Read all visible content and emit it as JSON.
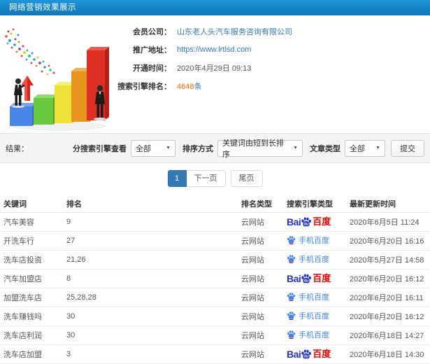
{
  "header": {
    "title": "网络营销效果展示"
  },
  "member": {
    "company_label": "会员公司：",
    "company_value": "山东老人头汽车服务咨询有限公司",
    "url_label": "推广地址：",
    "url_value": "https://www.lrtlsd.com",
    "open_label": "开通时间：",
    "open_value": "2020年4月29日 09:13",
    "rank_label": "搜索引擎排名：",
    "rank_count": "4648",
    "rank_unit": "条"
  },
  "filters": {
    "result_label": "结果：",
    "engine_label": "分搜索引擎查看",
    "engine_value": "全部",
    "sort_label": "排序方式",
    "sort_value": "关键词由短到长排序",
    "article_label": "文章类型",
    "article_value": "全部",
    "submit_label": "提交"
  },
  "pagination": {
    "current": "1",
    "next_label": "下一页",
    "last_label": "尾页"
  },
  "table": {
    "headers": [
      "关键词",
      "排名",
      "排名类型",
      "搜索引擎类型",
      "最新更新时间"
    ],
    "rows": [
      {
        "keyword": "汽车美容",
        "rank": "9",
        "rank_type": "云网站",
        "engine": "baidu",
        "updated": "2020年6月5日 11:24"
      },
      {
        "keyword": "开洗车行",
        "rank": "27",
        "rank_type": "云网站",
        "engine": "mobile",
        "updated": "2020年6月20日 16:16"
      },
      {
        "keyword": "洗车店投资",
        "rank": "21,26",
        "rank_type": "云网站",
        "engine": "mobile",
        "updated": "2020年5月27日 14:58"
      },
      {
        "keyword": "汽车加盟店",
        "rank": "8",
        "rank_type": "云网站",
        "engine": "baidu",
        "updated": "2020年6月20日 16:12"
      },
      {
        "keyword": "加盟洗车店",
        "rank": "25,28,28",
        "rank_type": "云网站",
        "engine": "mobile",
        "updated": "2020年6月20日 16:11"
      },
      {
        "keyword": "洗车赚钱吗",
        "rank": "30",
        "rank_type": "云网站",
        "engine": "mobile",
        "updated": "2020年6月20日 16:12"
      },
      {
        "keyword": "洗车店利润",
        "rank": "30",
        "rank_type": "云网站",
        "engine": "mobile",
        "updated": "2020年6月18日 14:27"
      },
      {
        "keyword": "洗车店加盟",
        "rank": "3",
        "rank_type": "云网站",
        "engine": "baidu",
        "updated": "2020年6月18日 14:30"
      }
    ]
  },
  "engines": {
    "baidu": {
      "prefix": "Bai",
      "paw_text": "du",
      "suffix": "百度"
    },
    "mobile": {
      "label": "手机百度"
    }
  },
  "colors": {
    "header_blue": "#1787cd",
    "link_blue": "#337ab7",
    "rank_orange": "#ff6600",
    "baidu_blue": "#2534c1",
    "baidu_red": "#e10601",
    "mobile_blue": "#3f83f0",
    "active_page_blue": "#337ab7"
  }
}
